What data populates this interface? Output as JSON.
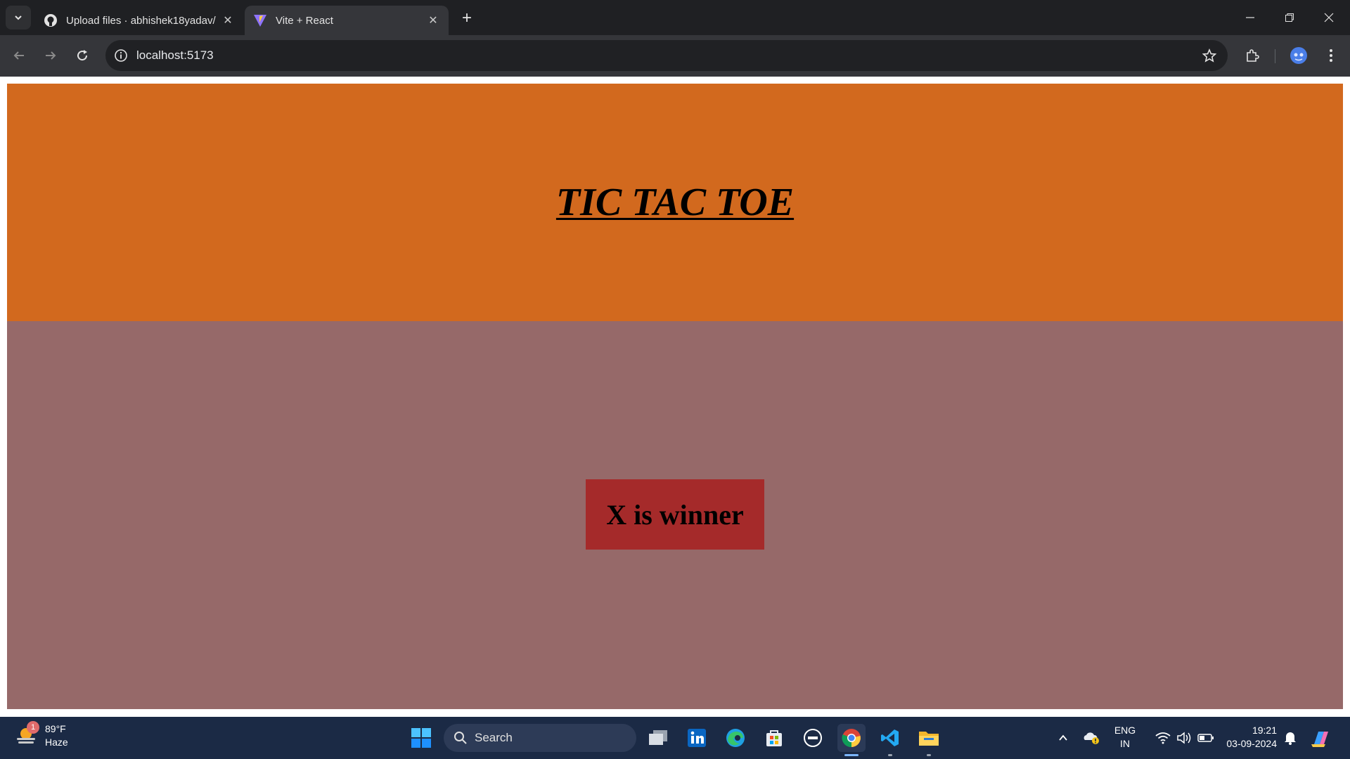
{
  "browser": {
    "tabs": [
      {
        "title": "Upload files · abhishek18yadav/",
        "icon": "github-icon",
        "active": false
      },
      {
        "title": "Vite + React",
        "icon": "vite-icon",
        "active": true
      }
    ],
    "url": "localhost:5173"
  },
  "page": {
    "title": "TIC TAC TOE",
    "winner_text": "X is winner",
    "colors": {
      "header": "#d2691e",
      "game_area": "#966969",
      "winner_box": "#a52a2a"
    }
  },
  "taskbar": {
    "weather": {
      "temp": "89°F",
      "condition": "Haze",
      "badge": "1"
    },
    "search_label": "Search",
    "language": {
      "line1": "ENG",
      "line2": "IN"
    },
    "time": "19:21",
    "date": "03-09-2024"
  }
}
